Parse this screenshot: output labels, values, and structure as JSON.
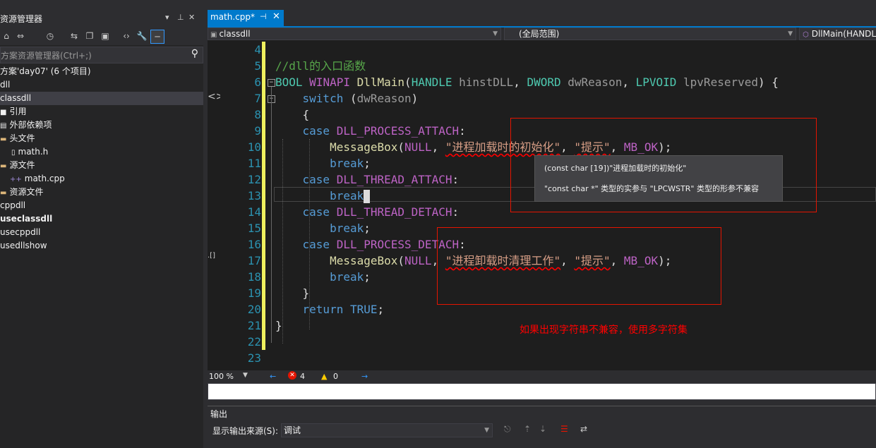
{
  "explorer": {
    "title": "资源管理器",
    "controls": [
      "▾",
      "⊥",
      "✕"
    ],
    "toolbar": [
      "⌂",
      "⇔",
      "◷",
      "⇆",
      "❐",
      "▣",
      "‹›",
      "🔧",
      "─"
    ],
    "search_placeholder": "方案资源管理器(Ctrl+;)",
    "search_icon": "⚲",
    "tree": [
      {
        "label": "方案'day07' (6 个项目)",
        "bold": false,
        "icon": ""
      },
      {
        "label": "dll",
        "bold": false,
        "icon": ""
      },
      {
        "label": "classdll",
        "bold": false,
        "icon": "",
        "selected": true
      },
      {
        "label": "引用",
        "bold": false,
        "icon": "■"
      },
      {
        "label": "外部依赖项",
        "bold": false,
        "icon": "▤"
      },
      {
        "label": "头文件",
        "bold": false,
        "icon": "▬"
      },
      {
        "label": "math.h",
        "bold": false,
        "icon": "▯"
      },
      {
        "label": "源文件",
        "bold": false,
        "icon": "▬"
      },
      {
        "label": "math.cpp",
        "bold": false,
        "icon": "++"
      },
      {
        "label": "资源文件",
        "bold": false,
        "icon": "▬"
      },
      {
        "label": "cppdll",
        "bold": false,
        "icon": ""
      },
      {
        "label": "useclassdll",
        "bold": true,
        "icon": ""
      },
      {
        "label": "usecppdll",
        "bold": false,
        "icon": ""
      },
      {
        "label": "usedllshow",
        "bold": false,
        "icon": ""
      }
    ]
  },
  "editor": {
    "tab": {
      "label": "math.cpp*",
      "pin": "⊣",
      "close": "✕"
    },
    "nav": {
      "project": "classdll",
      "scope": "(全局范围)",
      "member": "DllMain(HANDLE"
    },
    "line_numbers": [
      "4",
      "5",
      "6",
      "7",
      "8",
      "9",
      "10",
      "11",
      "12",
      "13",
      "14",
      "15",
      "16",
      "17",
      "18",
      "19",
      "20",
      "21",
      "22",
      "23"
    ],
    "code": {
      "l5_comment": "//dll的入口函数",
      "l6_bool": "BOOL",
      "l6_winapi": "WINAPI",
      "l6_fn": "DllMain",
      "l6_handle": "HANDLE",
      "l6_p1": "hinstDLL",
      "l6_dword": "DWORD",
      "l6_p2": "dwReason",
      "l6_lpvoid": "LPVOID",
      "l6_p3": "lpvReserved",
      "l7_switch": "switch",
      "l7_arg": "dwReason",
      "l9_case": "case",
      "l9_const": "DLL_PROCESS_ATTACH",
      "l10_fn": "MessageBox",
      "l10_null": "NULL",
      "l10_s1": "\"进程加载时的初始化\"",
      "l10_s2": "\"提示\"",
      "l10_ok": "MB_OK",
      "l11_break": "break",
      "l12_const": "DLL_THREAD_ATTACH",
      "l13_break": "break",
      "l14_const": "DLL_THREAD_DETACH",
      "l15_break": "break",
      "l16_const": "DLL_PROCESS_DETACH",
      "l17_fn": "MessageBox",
      "l17_null": "NULL",
      "l17_s1": "\"进程卸载时清理工作\"",
      "l17_s2": "\"提示\"",
      "l17_ok": "MB_OK",
      "l18_break": "break",
      "l20_return": "return",
      "l20_true": "TRUE"
    },
    "tooltip": {
      "line1": "(const char [19])\"进程加载时的初始化\"",
      "line2": "\"const char *\" 类型的实参与 \"LPCWSTR\" 类型的形参不兼容"
    },
    "annotation": "如果出现字符串不兼容，使用多字符集",
    "status": {
      "zoom": "100 %",
      "errors": "4",
      "warnings": "0"
    }
  },
  "output": {
    "title": "输出",
    "source_label": "显示输出来源(S):",
    "source_value": "调试"
  },
  "colors": {
    "accent": "#007acc",
    "annotation": "#ff0000",
    "change_bar": "#eff05e"
  }
}
